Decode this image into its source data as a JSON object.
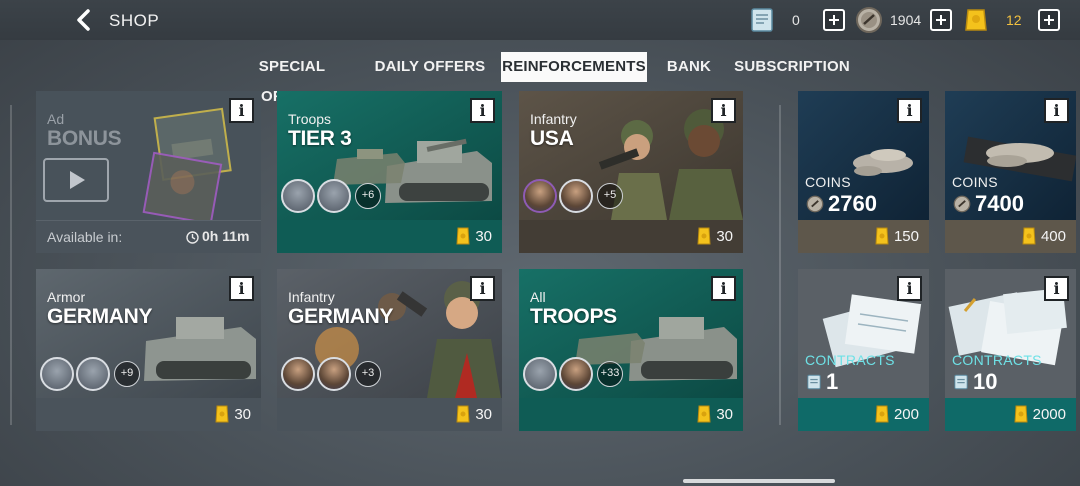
{
  "header": {
    "title": "SHOP",
    "resources": [
      {
        "name": "contracts",
        "value": "0"
      },
      {
        "name": "silver",
        "value": "1904"
      },
      {
        "name": "gold",
        "value": "12"
      }
    ]
  },
  "tabs": [
    {
      "label": "SPECIAL OFFERS",
      "active": false
    },
    {
      "label": "DAILY OFFERS",
      "active": false
    },
    {
      "label": "REINFORCEMENTS",
      "active": true
    },
    {
      "label": "BANK",
      "active": false
    },
    {
      "label": "SUBSCRIPTION",
      "active": false
    }
  ],
  "ad_card": {
    "sub": "Ad",
    "big": "BONUS",
    "available_label": "Available in:",
    "timer": "0h 11m"
  },
  "cards": [
    {
      "sub": "Troops",
      "big": "TIER 3",
      "more": "+6",
      "price": "30"
    },
    {
      "sub": "Infantry",
      "big": "USA",
      "more": "+5",
      "price": "30"
    },
    {
      "sub": "Armor",
      "big": "GERMANY",
      "more": "+9",
      "price": "30"
    },
    {
      "sub": "Infantry",
      "big": "GERMANY",
      "more": "+3",
      "price": "30"
    },
    {
      "sub": "All",
      "big": "TROOPS",
      "more": "+33",
      "price": "30"
    }
  ],
  "bank": [
    {
      "label": "COINS",
      "amount": "2760",
      "price": "150"
    },
    {
      "label": "COINS",
      "amount": "7400",
      "price": "400"
    },
    {
      "label": "CONTRACTS",
      "amount": "1",
      "price": "200"
    },
    {
      "label": "CONTRACTS",
      "amount": "10",
      "price": "2000"
    }
  ],
  "info_glyph": "i",
  "colors": {
    "accent_teal": "#0f6a61",
    "gold": "#f4c21c",
    "contract_text": "#6ee1e6"
  }
}
